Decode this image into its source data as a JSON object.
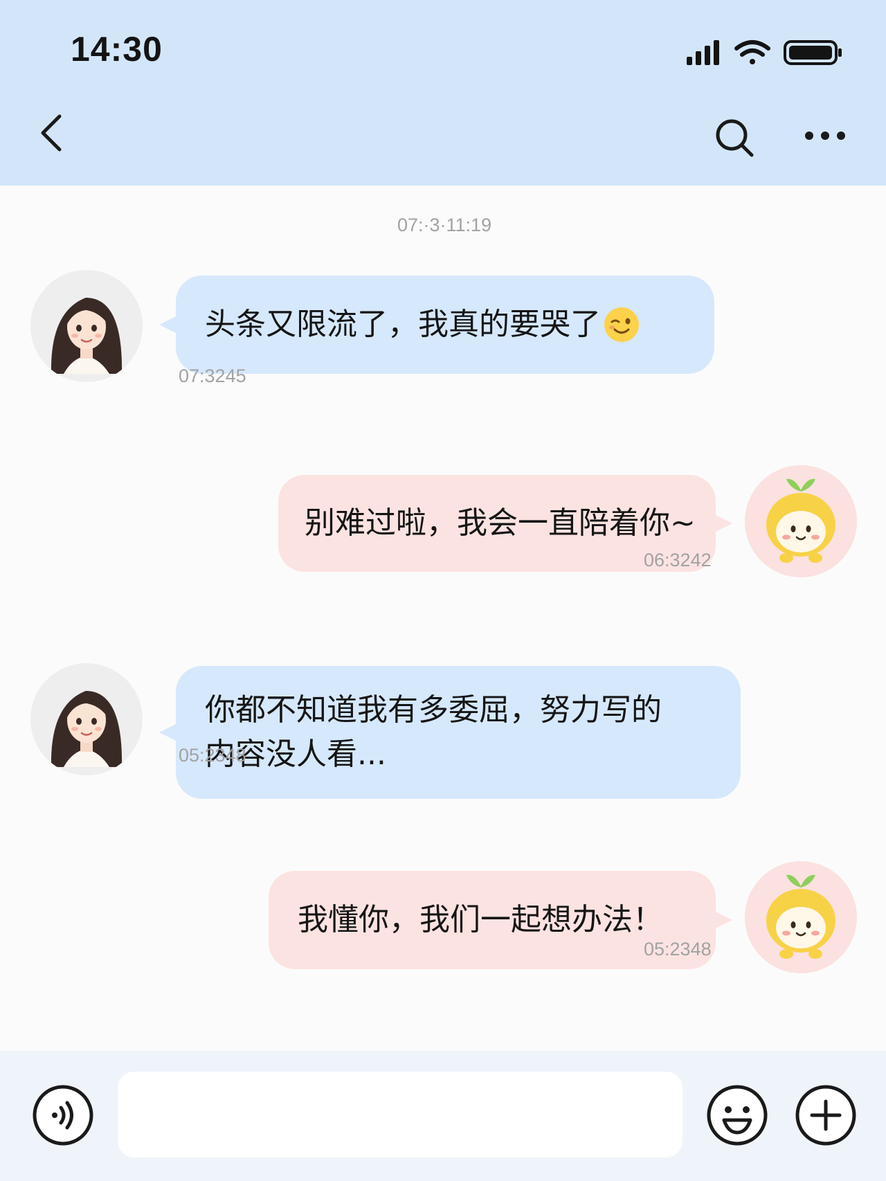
{
  "status_bar": {
    "time": "14:30"
  },
  "nav": {
    "back_icon": "chevron-left-icon",
    "search_icon": "search-icon",
    "more_icon": "more-dots-icon"
  },
  "chat": {
    "top_timestamp": "07:·3·11:19",
    "messages": [
      {
        "side": "in",
        "text": "头条又限流了，我真的要哭了",
        "emoji": "wink-face-emoji",
        "time": "07:3245"
      },
      {
        "side": "out",
        "text": "别难过啦，我会一直陪着你~",
        "time": "06:3242"
      },
      {
        "side": "in",
        "text": "你都不知道我有多委屈，努力写的\n内容没人看...",
        "time": "05:2348"
      },
      {
        "side": "out",
        "text": "我懂你，我们一起想办法！",
        "time": "05:2348"
      }
    ]
  },
  "input": {
    "value": "",
    "voice_icon": "voice-icon",
    "emoji_icon": "smiley-icon",
    "add_icon": "plus-icon"
  },
  "colors": {
    "header_bg": "#d3e6f9",
    "incoming_bubble": "#d6e8fb",
    "outgoing_bubble": "#fbe3e1",
    "timestamp": "#a2a2a2"
  }
}
